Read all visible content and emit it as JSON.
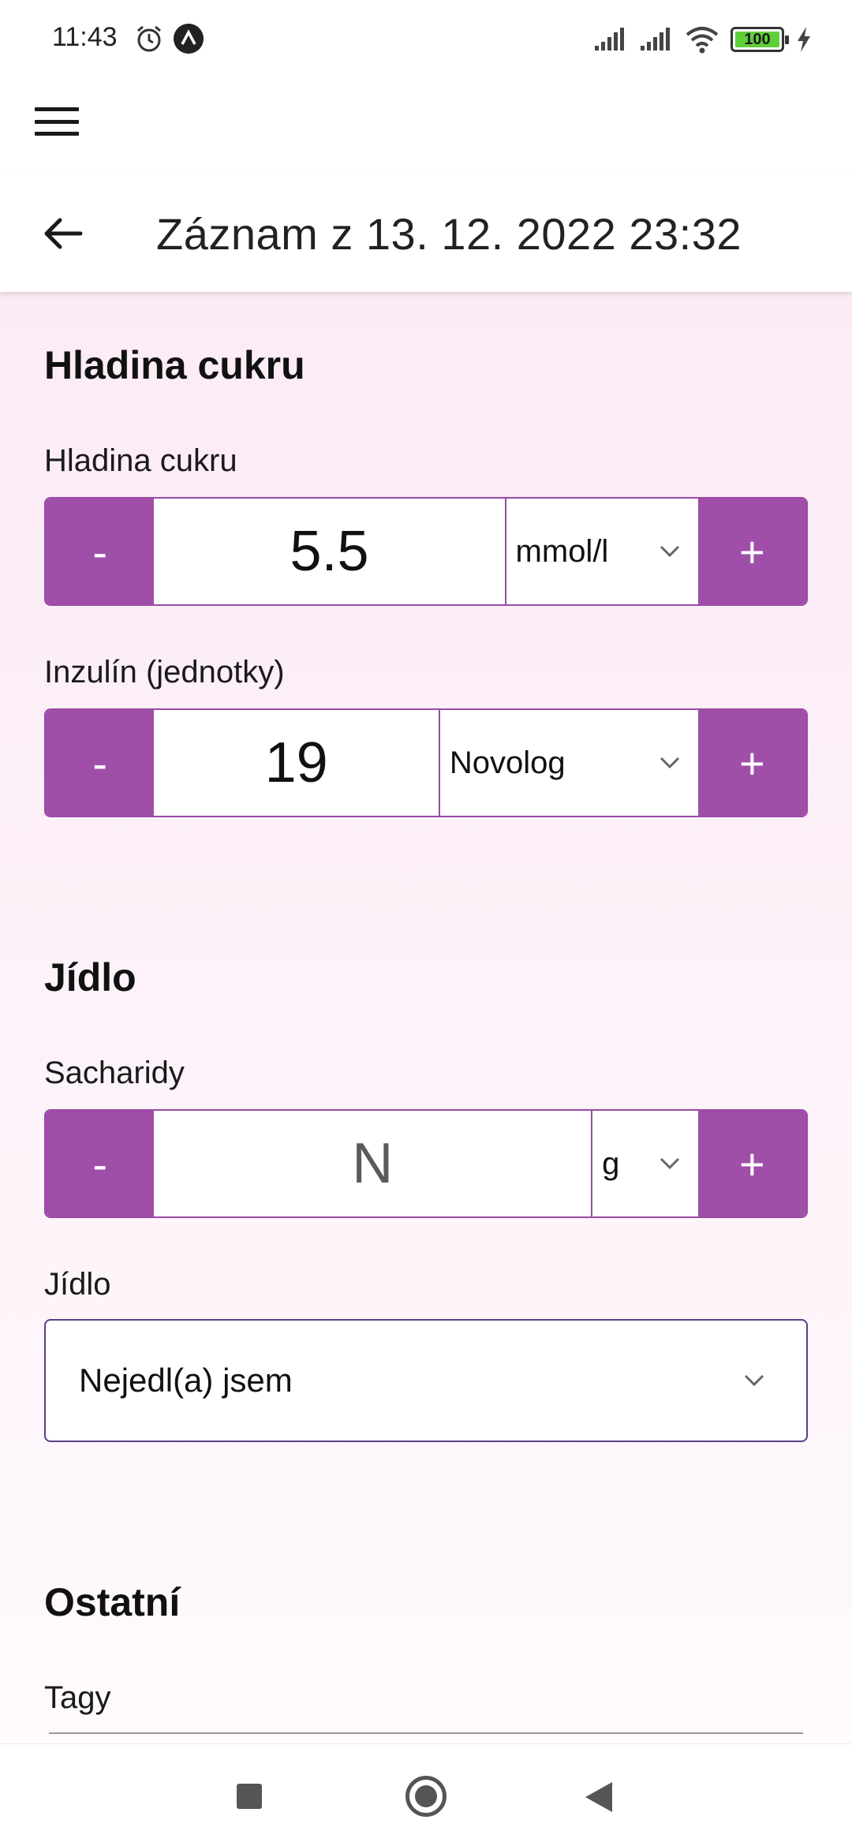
{
  "status_bar": {
    "time": "11:43",
    "battery": "100",
    "icons": [
      "alarm-icon",
      "app-notification-icon",
      "signal-icon",
      "signal-icon",
      "wifi-icon",
      "battery-icon",
      "charging-icon"
    ]
  },
  "header": {
    "title": "Záznam z 13. 12. 2022 23:32",
    "back_icon": "arrow-left-icon",
    "menu_icon": "hamburger-menu-icon"
  },
  "sections": {
    "sugar": {
      "title": "Hladina cukru",
      "glucose": {
        "label": "Hladina cukru",
        "minus": "-",
        "value": "5.5",
        "unit": "mmol/l",
        "plus": "+"
      },
      "insulin": {
        "label": "Inzulín (jednotky)",
        "minus": "-",
        "value": "19",
        "unit": "Novolog",
        "plus": "+"
      }
    },
    "food": {
      "title": "Jídlo",
      "carbs": {
        "label": "Sacharidy",
        "minus": "-",
        "value": "N",
        "unit": "g",
        "plus": "+"
      },
      "meal": {
        "label": "Jídlo",
        "selected": "Nejedl(a) jsem"
      }
    },
    "other": {
      "title": "Ostatní",
      "tags_label": "Tagy"
    }
  },
  "colors": {
    "accent": "#a04fa8",
    "background": "#fcebf6",
    "select_border": "#5b3f8a"
  }
}
